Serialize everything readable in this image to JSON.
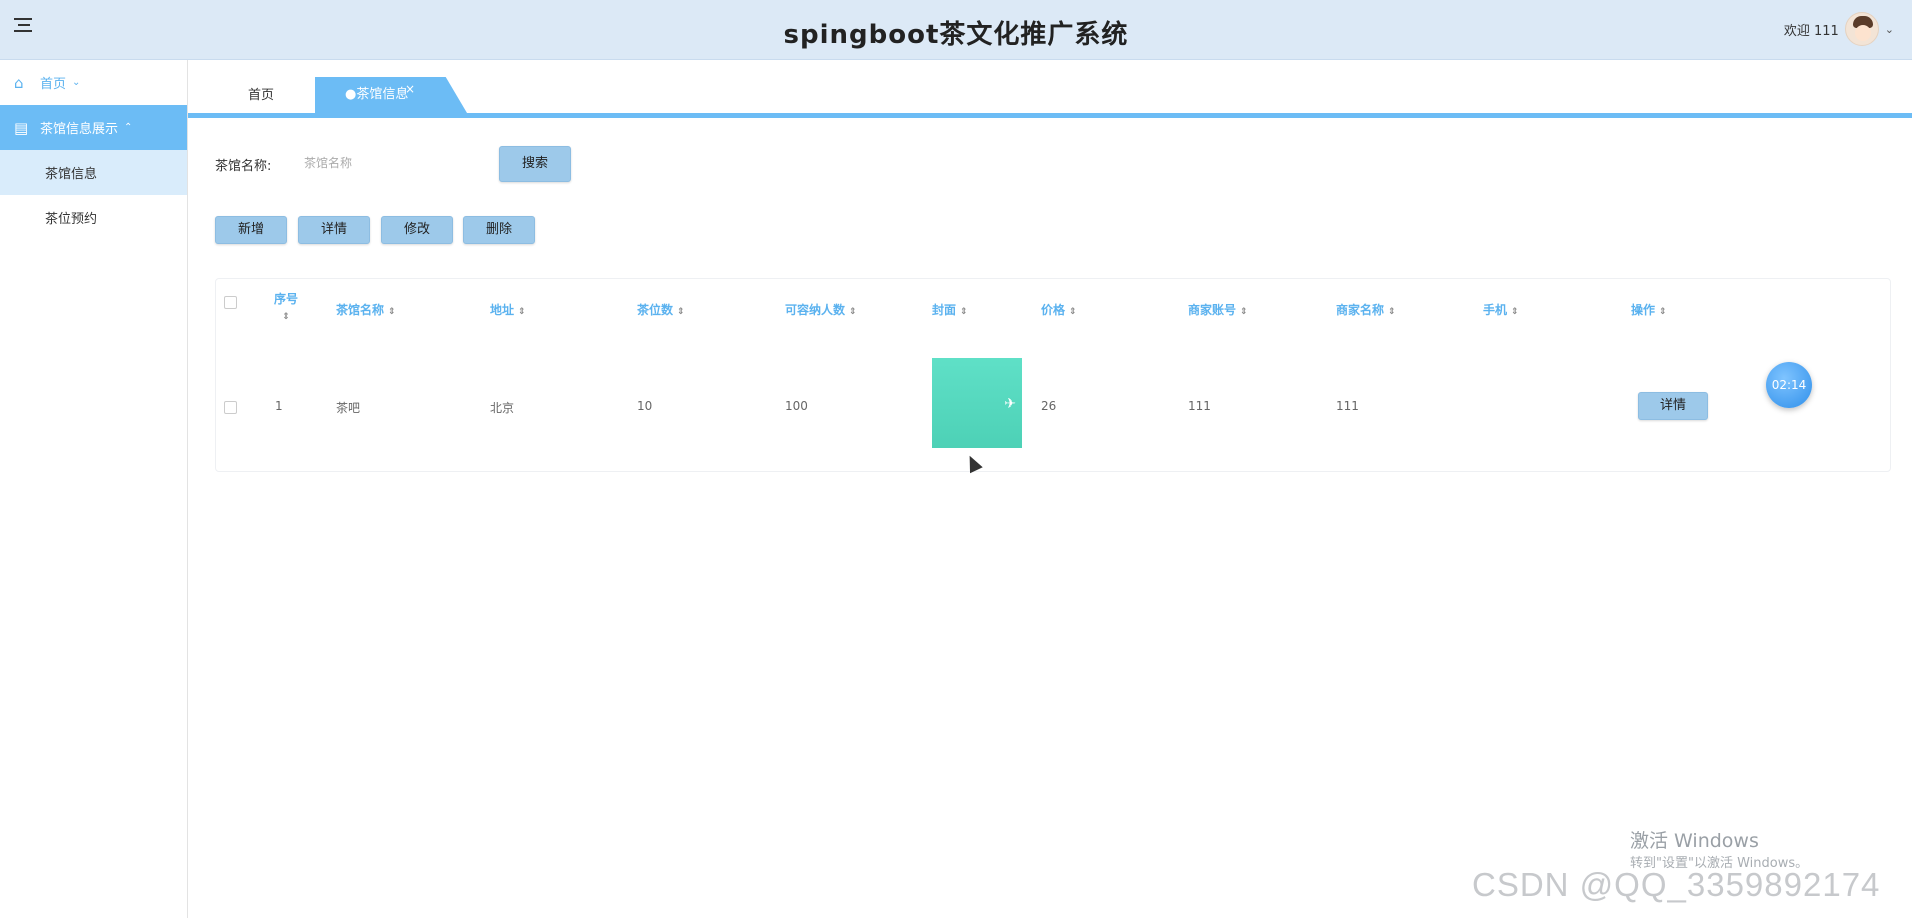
{
  "header": {
    "title": "spingboot茶文化推广系统",
    "welcome": "欢迎 111"
  },
  "sidebar": {
    "home": "首页",
    "group": "茶馆信息展示",
    "items": [
      {
        "label": "茶馆信息"
      },
      {
        "label": "茶位预约"
      }
    ]
  },
  "tabs": {
    "home": "首页",
    "active": "●茶馆信息",
    "close": "×"
  },
  "search": {
    "label": "茶馆名称:",
    "placeholder": "茶馆名称",
    "button": "搜索"
  },
  "actions": {
    "add": "新增",
    "detail": "详情",
    "edit": "修改",
    "delete": "删除"
  },
  "table": {
    "columns": [
      "序号",
      "茶馆名称",
      "地址",
      "茶位数",
      "可容纳人数",
      "封面",
      "价格",
      "商家账号",
      "商家名称",
      "手机",
      "操作"
    ],
    "rows": [
      {
        "index": "1",
        "name": "茶吧",
        "address": "北京",
        "seats": "10",
        "capacity": "100",
        "price": "26",
        "merchant_account": "111",
        "merchant_name": "111",
        "phone": "",
        "action": "详情"
      }
    ]
  },
  "timer": "02:14",
  "watermark": {
    "line1": "激活 Windows",
    "line2": "转到\"设置\"以激活 Windows。",
    "csdn": "CSDN @QQ_3359892174"
  },
  "colors": {
    "accent": "#6cbcf5",
    "header_bg": "#dce9f6",
    "button_bg": "#9dc9ea"
  }
}
